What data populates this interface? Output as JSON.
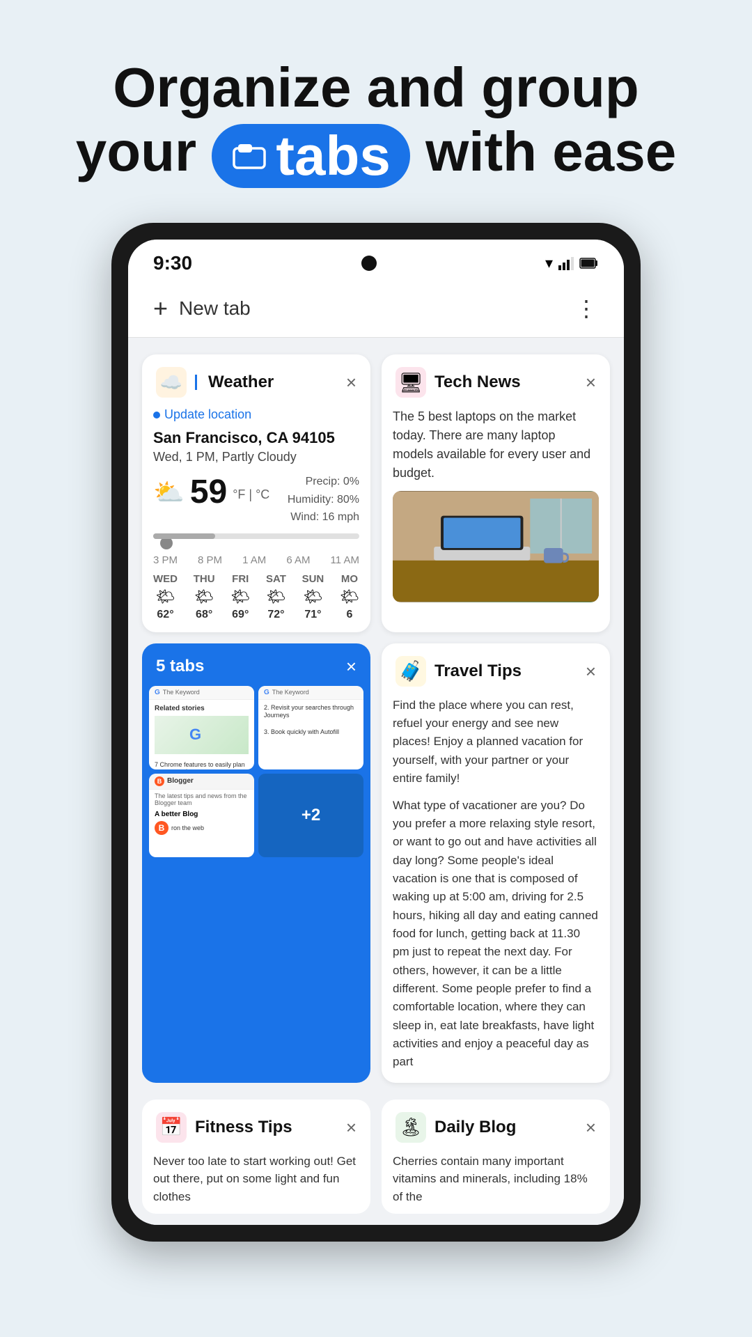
{
  "hero": {
    "line1": "Organize and group",
    "line2_pre": "your",
    "line2_highlight": " tabs",
    "line2_post": " with ease",
    "highlight_bg": "#1a73e8"
  },
  "phone": {
    "status_time": "9:30",
    "new_tab_label": "New tab",
    "menu_dots": "⋮"
  },
  "weather_card": {
    "title": "Weather",
    "close": "×",
    "update_location": "Update location",
    "location": "San Francisco, CA 94105",
    "description": "Wed, 1 PM, Partly Cloudy",
    "temp": "59",
    "temp_unit": "°F | °C",
    "precip": "Precip: 0%",
    "humidity": "Humidity: 80%",
    "wind": "Wind: 16 mph",
    "timeline_times": [
      "3 PM",
      "8 PM",
      "1 AM",
      "6 AM",
      "11 AM"
    ],
    "forecast": [
      {
        "day": "WED",
        "emoji": "🌤",
        "temp": "62°"
      },
      {
        "day": "THU",
        "emoji": "🌤",
        "temp": "68°"
      },
      {
        "day": "FRI",
        "emoji": "🌤",
        "temp": "69°"
      },
      {
        "day": "SAT",
        "emoji": "🌤",
        "temp": "72°"
      },
      {
        "day": "SUN",
        "emoji": "🌤",
        "temp": "71°"
      },
      {
        "day": "MO",
        "emoji": "🌤",
        "temp": "6"
      }
    ]
  },
  "tech_news_card": {
    "title": "Tech News",
    "close": "×",
    "article_text": "The 5 best laptops on the market today. There are many laptop models available for every user and budget."
  },
  "five_tabs_card": {
    "title": "5 tabs",
    "close": "×",
    "mini_tabs": [
      {
        "logo": "Google",
        "content": "Related stories",
        "has_image": true
      },
      {
        "logo": "Google",
        "content": "2. Revisit your searches through Journeys",
        "has_image": false
      }
    ],
    "blogger_label": "Blogger",
    "blogger_subtitle": "A better Blog",
    "blogger_content": "The latest tips and news from the Blogger team",
    "plus_count": "+2"
  },
  "travel_tips_card": {
    "title": "Travel Tips",
    "close": "×",
    "para1": "Find the place where you can rest, refuel your energy and see new places! Enjoy a planned vacation for yourself, with your partner or your entire family!",
    "para2": "What type of vacationer are you? Do you prefer a more relaxing style resort, or want to go out and have activities all day long? Some people's ideal vacation is one that is composed of waking up at 5:00 am, driving for 2.5 hours, hiking all day and eating canned food for lunch, getting back at 11.30 pm just to repeat the next day. For others, however, it can be a little different. Some people prefer to find a comfortable location, where they can sleep in, eat late breakfasts, have light activities and enjoy a peaceful day as part"
  },
  "fitness_tips_card": {
    "title": "Fitness Tips",
    "close": "×",
    "text": "Never too late to start working out! Get out there, put on some light and fun clothes"
  },
  "daily_blog_card": {
    "title": "Daily Blog",
    "close": "×",
    "text": "Cherries contain many important vitamins and minerals, including 18% of the"
  },
  "icons": {
    "weather_emoji": "🌤",
    "tech_emoji": "🖥",
    "travel_emoji": "🧳",
    "fitness_emoji": "📅",
    "blog_emoji": "🏝"
  }
}
